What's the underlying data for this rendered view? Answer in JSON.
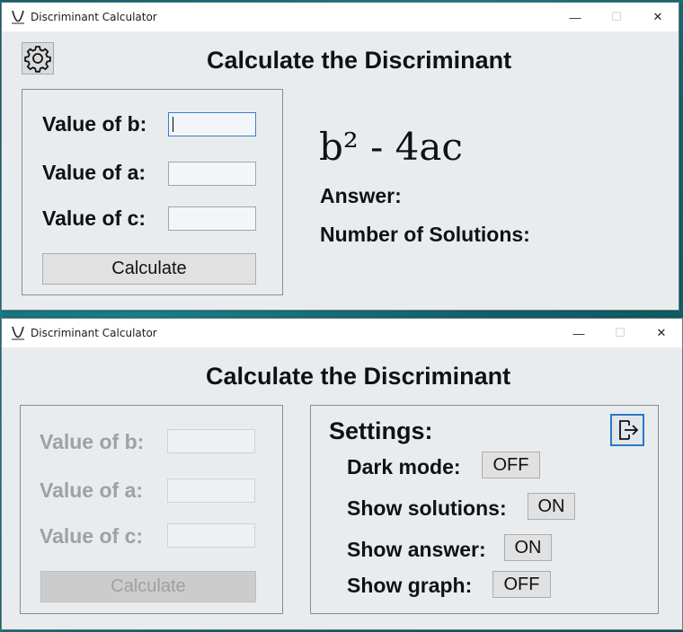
{
  "window1": {
    "title": "Discriminant Calculator",
    "controls": {
      "minimize": "—",
      "maximize": "☐",
      "close": "✕"
    },
    "heading": "Calculate the Discriminant",
    "settings_icon": "gear-icon",
    "inputs": [
      {
        "label": "Value of b:",
        "value": ""
      },
      {
        "label": "Value of a:",
        "value": ""
      },
      {
        "label": "Value of c:",
        "value": ""
      }
    ],
    "calculate_label": "Calculate",
    "formula": "b² - 4ac",
    "answer_label": "Answer:",
    "solutions_label": "Number of Solutions:"
  },
  "window2": {
    "title": "Discriminant Calculator",
    "controls": {
      "minimize": "—",
      "maximize": "☐",
      "close": "✕"
    },
    "heading": "Calculate the Discriminant",
    "inputs": [
      {
        "label": "Value of b:",
        "value": ""
      },
      {
        "label": "Value of a:",
        "value": ""
      },
      {
        "label": "Value of c:",
        "value": ""
      }
    ],
    "calculate_label": "Calculate",
    "settings": {
      "title": "Settings:",
      "exit_icon": "exit-icon",
      "items": [
        {
          "label": "Dark mode:",
          "state": "OFF"
        },
        {
          "label": "Show solutions:",
          "state": "ON"
        },
        {
          "label": "Show answer:",
          "state": "ON"
        },
        {
          "label": "Show graph:",
          "state": "OFF"
        }
      ]
    }
  }
}
